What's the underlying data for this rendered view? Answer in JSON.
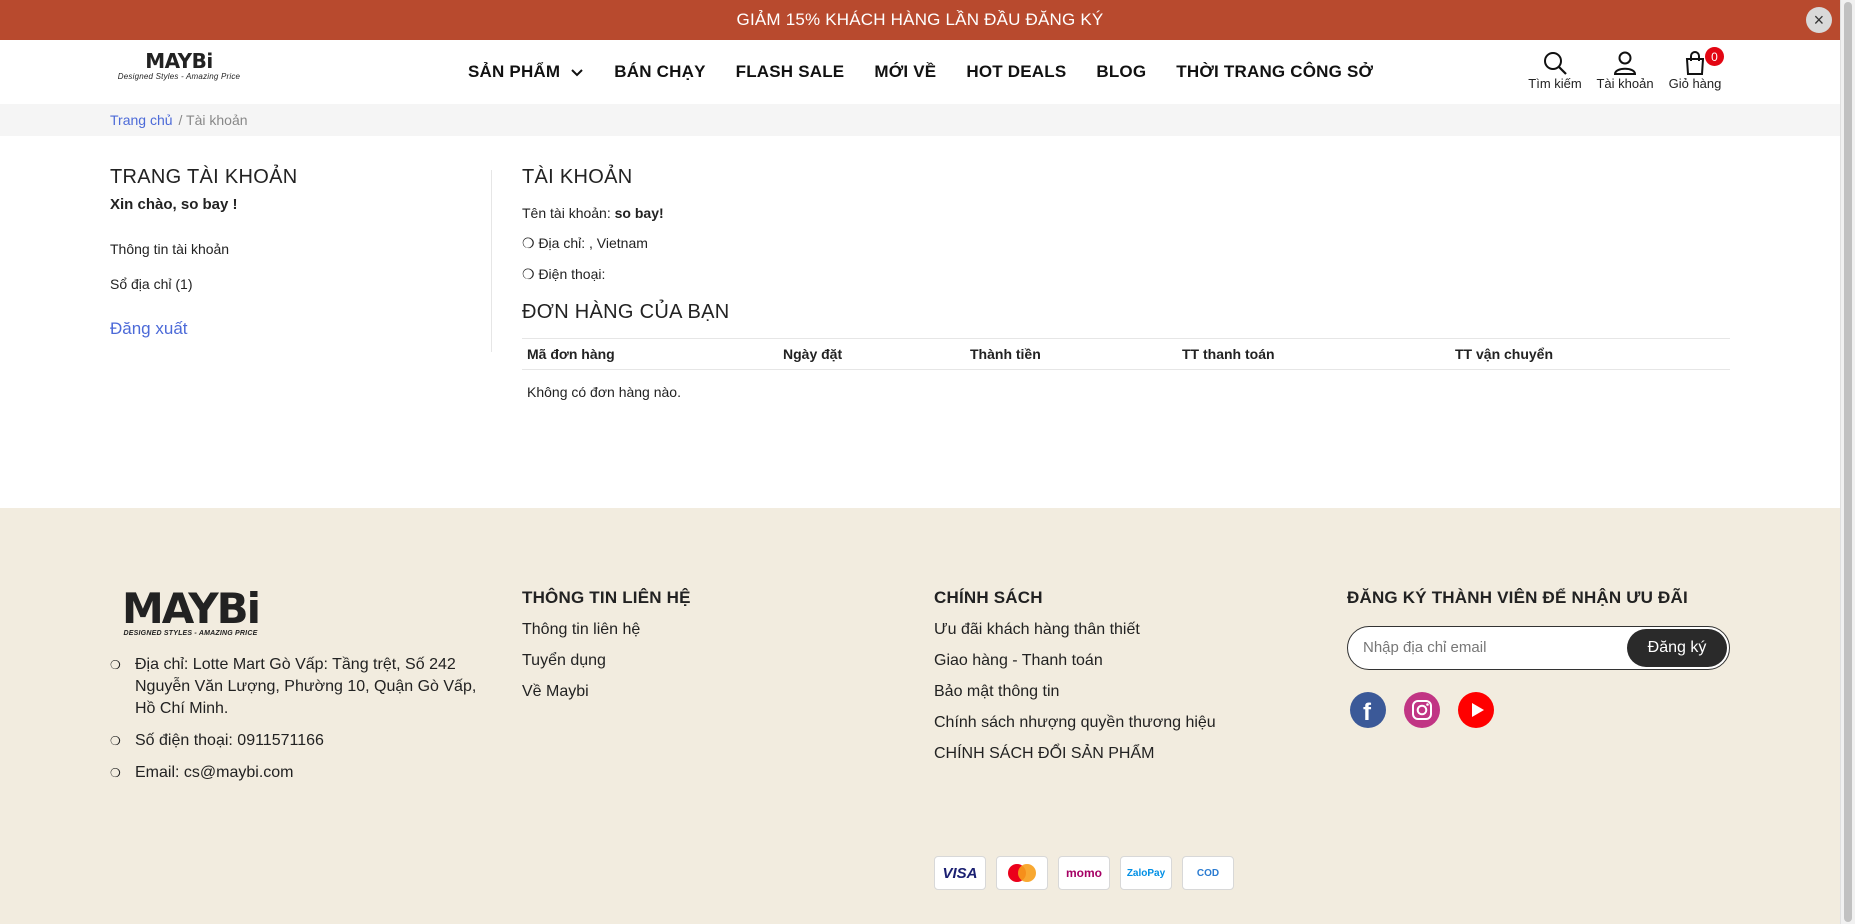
{
  "banner": {
    "text": "GIẢM 15% KHÁCH HÀNG LẦN ĐẦU ĐĂNG KÝ",
    "close": "×"
  },
  "header": {
    "logo": {
      "word": "MAYBi",
      "tagline": "Designed Styles - Amazing Price"
    },
    "nav": [
      "SẢN PHẨM",
      "BÁN CHẠY",
      "FLASH SALE",
      "MỚI VỀ",
      "HOT DEALS",
      "BLOG",
      "THỜI TRANG CÔNG SỞ"
    ],
    "icons": {
      "search": "Tìm kiếm",
      "account": "Tài khoản",
      "cart": "Giỏ hàng",
      "cart_count": "0"
    }
  },
  "breadcrumb": {
    "home": "Trang chủ",
    "current": "/ Tài khoản"
  },
  "sidebar": {
    "title": "TRANG TÀI KHOẢN",
    "greeting": "Xin chào, so bay !",
    "links": [
      "Thông tin tài khoản",
      "Sổ địa chỉ (1)"
    ],
    "logout": "Đăng xuất"
  },
  "account": {
    "title": "TÀI KHOẢN",
    "name_label": "Tên tài khoản: ",
    "name_value": "so bay!",
    "address": "❍ Địa chỉ: , Vietnam",
    "phone": "❍ Điện thoại:"
  },
  "orders": {
    "title": "ĐƠN HÀNG CỦA BẠN",
    "columns": [
      "Mã đơn hàng",
      "Ngày đặt",
      "Thành tiền",
      "TT thanh toán",
      "TT vận chuyển"
    ],
    "empty": "Không có đơn hàng nào."
  },
  "footer": {
    "logo": {
      "word": "MAYBi",
      "tagline": "DESIGNED STYLES - AMAZING PRICE"
    },
    "contact_lines": [
      "Địa chỉ: Lotte Mart Gò Vấp: Tầng trệt, Số 242 Nguyễn Văn Lượng, Phường 10, Quận Gò Vấp, Hồ Chí Minh.",
      "Số điện thoại: 0911571166",
      "Email: cs@maybi.com"
    ],
    "info": {
      "title": "THÔNG TIN LIÊN HỆ",
      "links": [
        "Thông tin liên hệ",
        "Tuyển dụng",
        "Về Maybi"
      ]
    },
    "policy": {
      "title": "CHÍNH SÁCH",
      "links": [
        "Ưu đãi khách hàng thân thiết",
        "Giao hàng - Thanh toán",
        "Bảo mật thông tin",
        "Chính sách nhượng quyền thương hiệu",
        "CHÍNH SÁCH ĐỔI SẢN PHẨM"
      ]
    },
    "subscribe": {
      "title": "ĐĂNG KÝ THÀNH VIÊN ĐỂ NHẬN ƯU ĐÃI",
      "placeholder": "Nhập địa chỉ email",
      "button": "Đăng ký"
    },
    "payments": [
      "VISA",
      "mastercard",
      "momo",
      "ZaloPay",
      "COD"
    ],
    "colors": {
      "banner": "#b84a2e",
      "footer_bg": "#f2ecdf",
      "link_blue": "#4c6ad8",
      "badge": "#e30613"
    }
  }
}
